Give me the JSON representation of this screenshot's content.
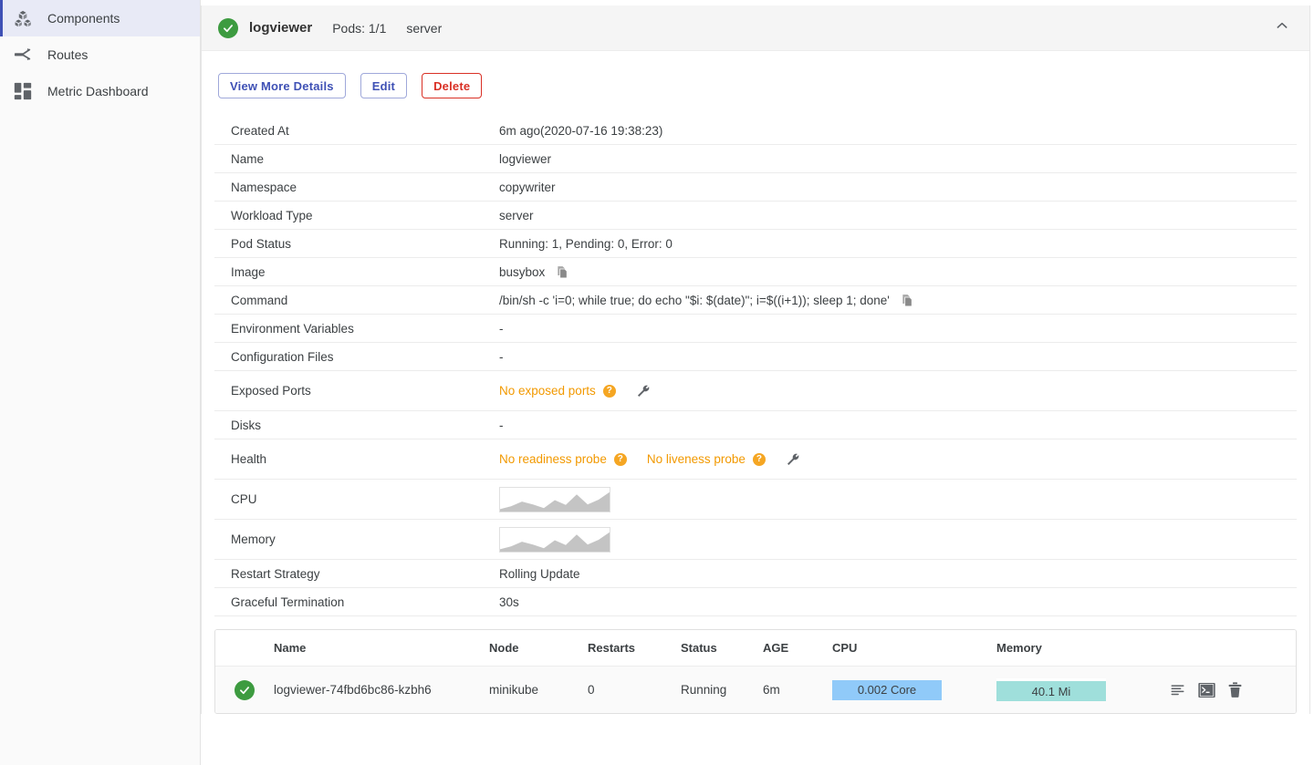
{
  "sidebar": {
    "items": [
      {
        "label": "Components",
        "icon": "cubes-icon",
        "active": true
      },
      {
        "label": "Routes",
        "icon": "route-branch-icon",
        "active": false
      },
      {
        "label": "Metric Dashboard",
        "icon": "dashboard-grid-icon",
        "active": false
      }
    ]
  },
  "header": {
    "status_icon": "check-circle-icon",
    "title": "logviewer",
    "pods": "Pods: 1/1",
    "workload": "server",
    "collapse_icon": "chevron-up-icon"
  },
  "toolbar": {
    "view_more_label": "View More Details",
    "edit_label": "Edit",
    "delete_label": "Delete"
  },
  "details": [
    {
      "key": "Created At",
      "value": "6m ago(2020-07-16 19:38:23)"
    },
    {
      "key": "Name",
      "value": "logviewer"
    },
    {
      "key": "Namespace",
      "value": "copywriter"
    },
    {
      "key": "Workload Type",
      "value": "server"
    },
    {
      "key": "Pod Status",
      "value": "Running: 1, Pending: 0, Error: 0"
    },
    {
      "key": "Image",
      "value": "busybox"
    },
    {
      "key": "Command",
      "value": "/bin/sh -c 'i=0; while true; do echo \"$i: $(date)\"; i=$((i+1)); sleep 1; done'"
    },
    {
      "key": "Environment Variables",
      "value": "-"
    },
    {
      "key": "Configuration Files",
      "value": "-"
    },
    {
      "key": "Exposed Ports",
      "value": "No exposed ports"
    },
    {
      "key": "Disks",
      "value": "-"
    },
    {
      "key": "Health",
      "value": "No readiness probe"
    },
    {
      "key": "Health2",
      "value": "No liveness probe"
    },
    {
      "key": "CPU",
      "value": ""
    },
    {
      "key": "Memory",
      "value": ""
    },
    {
      "key": "Restart Strategy",
      "value": "Rolling Update"
    },
    {
      "key": "Graceful Termination",
      "value": "30s"
    }
  ],
  "labels": {
    "created_at": "Created At",
    "name": "Name",
    "namespace": "Namespace",
    "workload_type": "Workload Type",
    "pod_status": "Pod Status",
    "image": "Image",
    "command": "Command",
    "env_vars": "Environment Variables",
    "config_files": "Configuration Files",
    "exposed_ports": "Exposed Ports",
    "disks": "Disks",
    "health": "Health",
    "cpu": "CPU",
    "memory": "Memory",
    "restart_strategy": "Restart Strategy",
    "graceful_termination": "Graceful Termination"
  },
  "values": {
    "created_at": "6m ago(2020-07-16 19:38:23)",
    "name": "logviewer",
    "namespace": "copywriter",
    "workload_type": "server",
    "pod_status": "Running: 1, Pending: 0, Error: 0",
    "image": "busybox",
    "command": "/bin/sh -c 'i=0; while true; do echo \"$i: $(date)\"; i=$((i+1)); sleep 1; done'",
    "env_vars": "-",
    "config_files": "-",
    "exposed_ports": "No exposed ports",
    "disks": "-",
    "readiness": "No readiness probe",
    "liveness": "No liveness probe",
    "restart_strategy": "Rolling Update",
    "graceful_termination": "30s",
    "help_glyph": "?"
  },
  "pod_table": {
    "columns": [
      "Name",
      "Node",
      "Restarts",
      "Status",
      "AGE",
      "CPU",
      "Memory"
    ],
    "rows": [
      {
        "status_icon": "check-circle-icon",
        "name": "logviewer-74fbd6bc86-kzbh6",
        "node": "minikube",
        "restarts": "0",
        "status": "Running",
        "age": "6m",
        "cpu": "0.002 Core",
        "memory": "40.1 Mi",
        "actions": [
          "log-icon",
          "terminal-icon",
          "trash-icon"
        ]
      }
    ]
  },
  "chart_data": [
    {
      "type": "area",
      "title": "CPU",
      "x": [
        0,
        1,
        2,
        3,
        4,
        5,
        6,
        7,
        8,
        9,
        10
      ],
      "values": [
        0.1,
        0.22,
        0.42,
        0.3,
        0.18,
        0.52,
        0.28,
        0.72,
        0.3,
        0.5,
        0.82
      ],
      "xlabel": "",
      "ylabel": "",
      "ylim": [
        0,
        1
      ],
      "grid": false,
      "legend": "none"
    },
    {
      "type": "area",
      "title": "Memory",
      "x": [
        0,
        1,
        2,
        3,
        4,
        5,
        6,
        7,
        8,
        9,
        10
      ],
      "values": [
        0.1,
        0.22,
        0.42,
        0.3,
        0.18,
        0.52,
        0.28,
        0.72,
        0.3,
        0.5,
        0.82
      ],
      "xlabel": "",
      "ylabel": "",
      "ylim": [
        0,
        1
      ],
      "grid": false,
      "legend": "none"
    }
  ],
  "colors": {
    "accent": "#3f51b5",
    "danger": "#d93025",
    "warning": "#f29900",
    "success": "#3d9b40",
    "cpu_bar": "#90caf9",
    "mem_bar": "#9fdfdb"
  }
}
